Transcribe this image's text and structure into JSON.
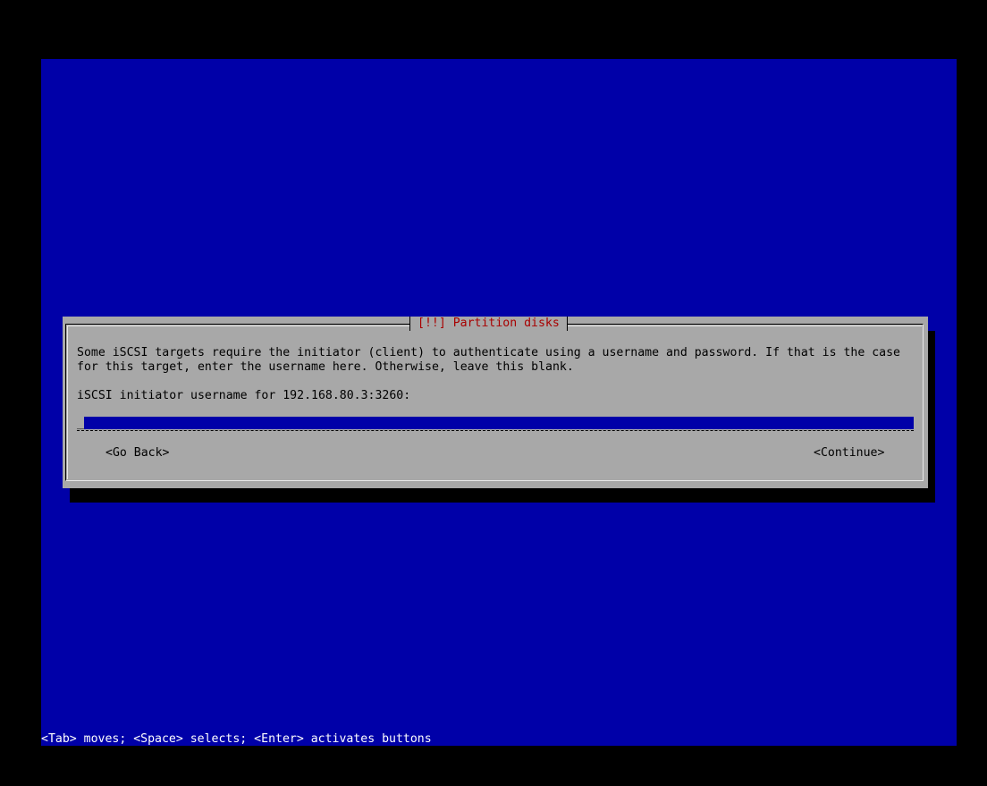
{
  "dialog": {
    "title": "[!!] Partition disks",
    "description_line1": "Some iSCSI targets require the initiator (client) to authenticate using a username and password. If that is the case",
    "description_line2": "for this target, enter the username here. Otherwise, leave this blank.",
    "prompt": "iSCSI initiator username for 192.168.80.3:3260:",
    "input_value": "",
    "cursor": "_",
    "go_back_label": "<Go Back>",
    "continue_label": "<Continue>"
  },
  "statusbar": {
    "hint": "<Tab> moves; <Space> selects; <Enter> activates buttons"
  },
  "colors": {
    "background": "#0000a8",
    "dialog": "#a8a8a8",
    "title": "#a80000",
    "input_bg": "#0000a8"
  }
}
